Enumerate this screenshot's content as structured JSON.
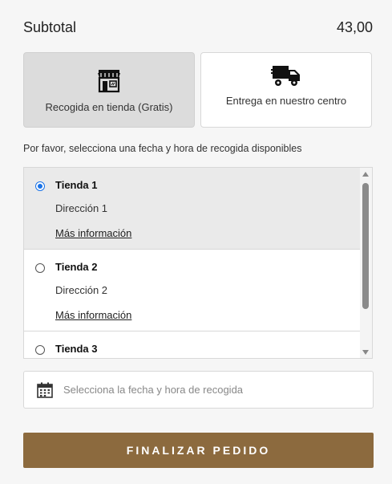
{
  "summary": {
    "subtotal_label": "Subtotal",
    "subtotal_value": "43,00"
  },
  "delivery_methods": [
    {
      "label": "Recogida en tienda (Gratis)",
      "icon": "store-icon",
      "selected": true
    },
    {
      "label": "Entrega en nuestro centro",
      "icon": "truck-icon",
      "selected": false
    }
  ],
  "pickup": {
    "hint": "Por favor, selecciona una fecha y hora de recogida disponibles",
    "stores": [
      {
        "name": "Tienda 1",
        "address": "Dirección 1",
        "more": "Más información",
        "selected": true
      },
      {
        "name": "Tienda 2",
        "address": "Dirección 2",
        "more": "Más información",
        "selected": false
      },
      {
        "name": "Tienda 3",
        "address": "",
        "more": "",
        "selected": false
      }
    ]
  },
  "date_field": {
    "placeholder": "Selecciona la fecha y hora de recogida",
    "icon": "calendar-icon"
  },
  "checkout": {
    "button_label": "FINALIZAR PEDIDO",
    "button_color": "#8c6a3e"
  }
}
